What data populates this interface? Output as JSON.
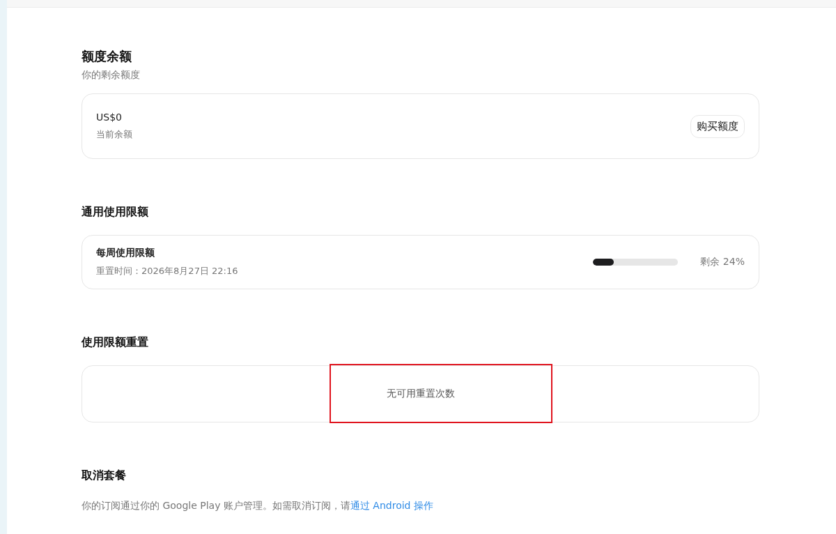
{
  "balance": {
    "title": "额度余额",
    "subtitle": "你的剩余额度",
    "amount": "US$0",
    "amount_label": "当前余额",
    "button": "购买额度"
  },
  "usage": {
    "title": "通用使用限额",
    "limits": [
      {
        "name": "每周使用限额",
        "reset": "重置时间：2026年8月27日 22:16",
        "level": 0.24,
        "reading": "剩余 24%"
      }
    ]
  },
  "reset": {
    "title": "使用限额重置",
    "empty": "无可用重置次数",
    "highlighted": true
  },
  "cancel": {
    "title": "取消套餐",
    "text": "你的订阅通过你的 Google Play 账户管理。如需取消订阅，请",
    "link": "通过 Android 操作"
  }
}
